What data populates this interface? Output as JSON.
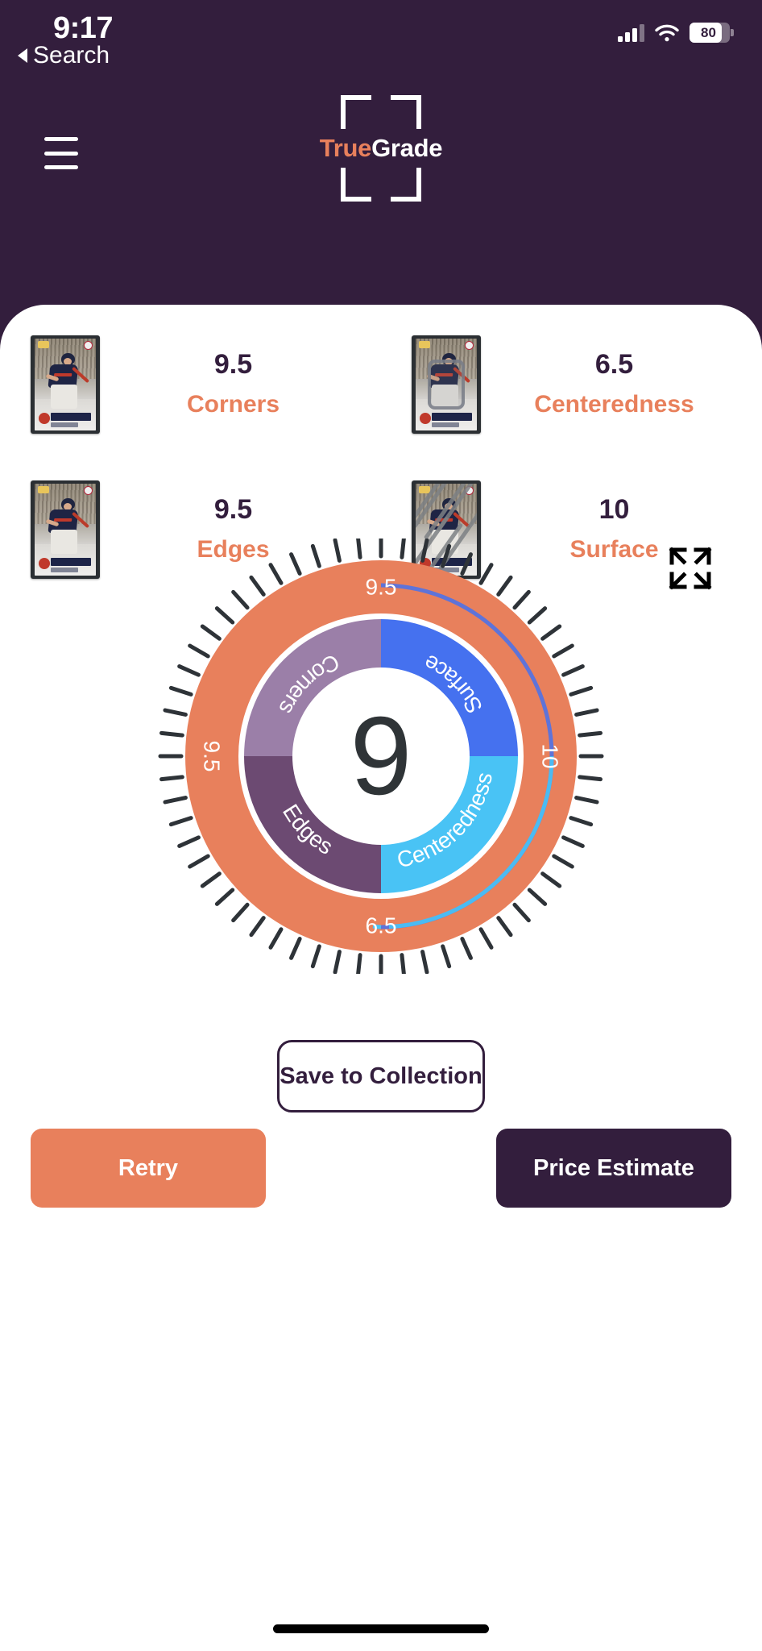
{
  "status_bar": {
    "time": "9:17",
    "battery_percent": "80",
    "battery_level": 80,
    "signal_icon": "cellular-signal-icon",
    "wifi_icon": "wifi-icon",
    "battery_icon": "battery-icon"
  },
  "back_nav": {
    "label": "Search",
    "icon": "back-triangle-icon"
  },
  "header": {
    "menu_icon": "hamburger-menu-icon",
    "logo_frame_icon": "scan-brackets-icon",
    "logo_first": "True",
    "logo_second": "Grade",
    "brand_accent": "#E8805C",
    "brand_dark": "#331E3D"
  },
  "metrics": [
    {
      "score": "9.5",
      "label": "Corners",
      "thumb_overlay": "none",
      "thumb_name": "card-thumbnail-corners"
    },
    {
      "score": "6.5",
      "label": "Centeredness",
      "thumb_overlay": "center-box",
      "thumb_name": "card-thumbnail-centeredness"
    },
    {
      "score": "9.5",
      "label": "Edges",
      "thumb_overlay": "none",
      "thumb_name": "card-thumbnail-edges"
    },
    {
      "score": "10",
      "label": "Surface",
      "thumb_overlay": "scratches",
      "thumb_name": "card-thumbnail-surface"
    }
  ],
  "expand_button": {
    "icon": "expand-fullscreen-icon"
  },
  "chart_data": {
    "type": "pie",
    "title": "",
    "overall_grade": "9",
    "outer_ring_labels": [
      {
        "text": "9.5",
        "position": "top"
      },
      {
        "text": "10",
        "position": "right"
      },
      {
        "text": "6.5",
        "position": "bottom"
      },
      {
        "text": "9.5",
        "position": "left"
      }
    ],
    "categories": [
      "Surface",
      "Centeredness",
      "Edges",
      "Corners"
    ],
    "values": [
      10,
      6.5,
      9.5,
      9.5
    ],
    "slice_colors": [
      "#4571EF",
      "#49C3F5",
      "#6C4A72",
      "#9B7FA8"
    ],
    "slice_angles_deg": [
      90,
      90,
      90,
      90
    ],
    "outer_ring_color": "#E8805C",
    "center_text": "9",
    "center_text_color": "#2F3437",
    "tick_count": 60,
    "tick_color": "#2E3338",
    "legend": "inline-on-slices",
    "grid": false
  },
  "actions": {
    "save_label": "Save to Collection",
    "retry_label": "Retry",
    "price_label": "Price Estimate"
  }
}
